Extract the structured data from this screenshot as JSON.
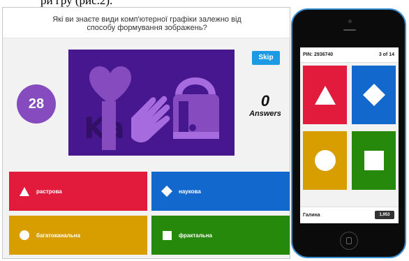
{
  "caption": "ри гру (рис.2).",
  "question": {
    "line1": "Які ви знаєте види комп'ютерної графіки залежно від",
    "line2": "способу формування зображень?"
  },
  "timer": "28",
  "skip_label": "Skip",
  "media_logo": "Ka",
  "answers": {
    "count": "0",
    "label": "Answers"
  },
  "options": [
    {
      "label": "растрова",
      "shape": "triangle-icon",
      "color": "#e21b3c"
    },
    {
      "label": "наукова",
      "shape": "diamond-icon",
      "color": "#1368ce"
    },
    {
      "label": "багатоканальна",
      "shape": "circle-icon",
      "color": "#d89e00"
    },
    {
      "label": "фрактальна",
      "shape": "square-icon",
      "color": "#26890c"
    }
  ],
  "phone": {
    "pin": "PIN: 2936740",
    "progress": "3 of 14",
    "player_name": "Галина",
    "score": "1,953"
  },
  "colors": {
    "purple": "#864cbf",
    "media_bg": "#46178f",
    "skip": "#1c9be4"
  }
}
